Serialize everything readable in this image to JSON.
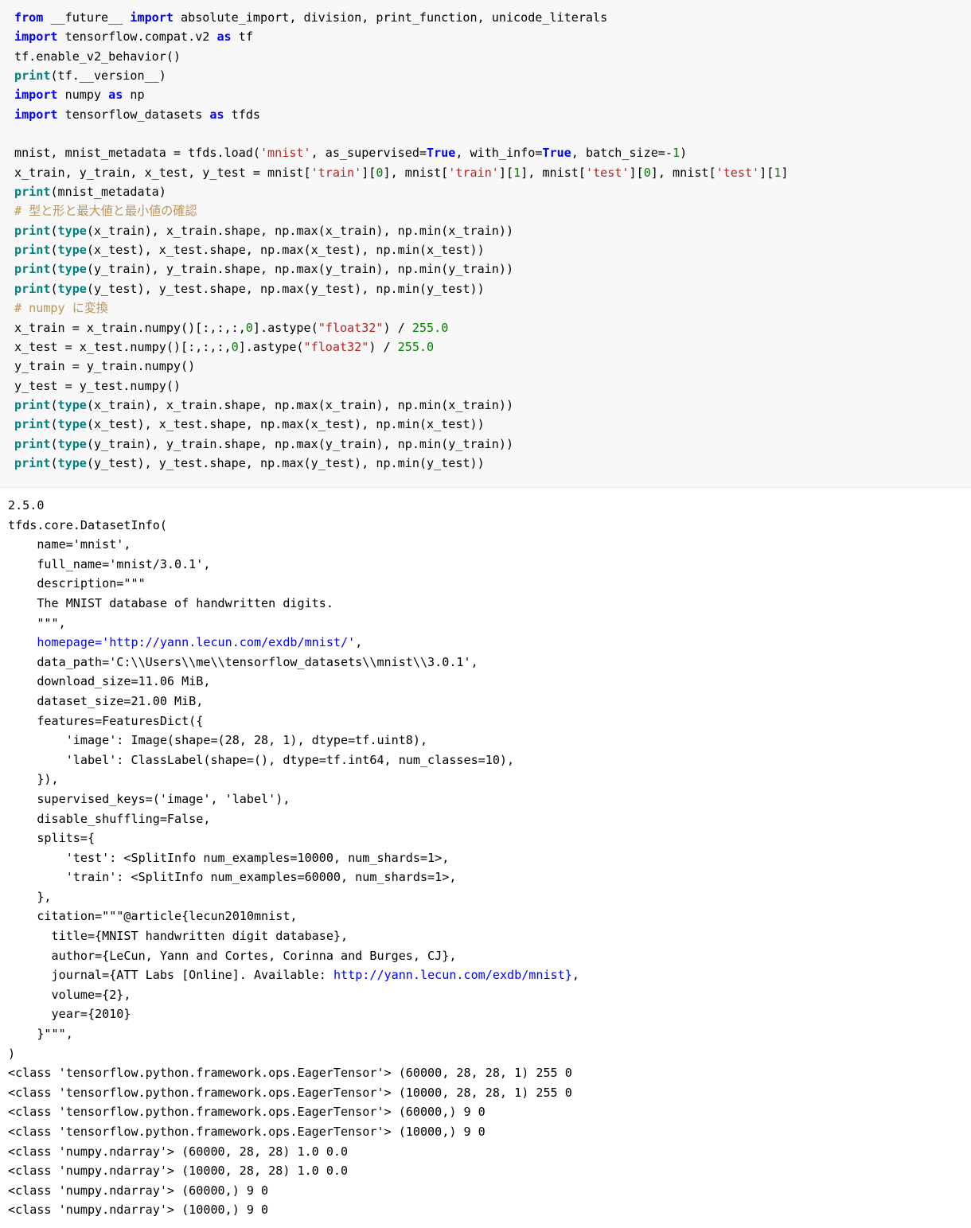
{
  "notebook": {
    "code_cell": {
      "language": "python",
      "background_color": "#f8f8f8",
      "lines": [
        [
          {
            "t": "from",
            "c": "kw"
          },
          {
            "t": " __future__ ",
            "c": ""
          },
          {
            "t": "import",
            "c": "kw"
          },
          {
            "t": " absolute_import, division, print_function, unicode_literals",
            "c": ""
          }
        ],
        [
          {
            "t": "import",
            "c": "kw"
          },
          {
            "t": " tensorflow.compat.v2 ",
            "c": ""
          },
          {
            "t": "as",
            "c": "kw"
          },
          {
            "t": " tf",
            "c": ""
          }
        ],
        [
          {
            "t": "tf.enable_v2_behavior()",
            "c": ""
          }
        ],
        [
          {
            "t": "print",
            "c": "bi"
          },
          {
            "t": "(tf.__version__)",
            "c": ""
          }
        ],
        [
          {
            "t": "import",
            "c": "kw"
          },
          {
            "t": " numpy ",
            "c": ""
          },
          {
            "t": "as",
            "c": "kw"
          },
          {
            "t": " np",
            "c": ""
          }
        ],
        [
          {
            "t": "import",
            "c": "kw"
          },
          {
            "t": " tensorflow_datasets ",
            "c": ""
          },
          {
            "t": "as",
            "c": "kw"
          },
          {
            "t": " tfds",
            "c": ""
          }
        ],
        [
          {
            "t": "",
            "c": ""
          }
        ],
        [
          {
            "t": "mnist, mnist_metadata = tfds.load(",
            "c": ""
          },
          {
            "t": "'mnist'",
            "c": "str"
          },
          {
            "t": ", as_supervised=",
            "c": ""
          },
          {
            "t": "True",
            "c": "cst"
          },
          {
            "t": ", with_info=",
            "c": ""
          },
          {
            "t": "True",
            "c": "cst"
          },
          {
            "t": ", batch_size=-",
            "c": ""
          },
          {
            "t": "1",
            "c": "num"
          },
          {
            "t": ")",
            "c": ""
          }
        ],
        [
          {
            "t": "x_train, y_train, x_test, y_test = mnist[",
            "c": ""
          },
          {
            "t": "'train'",
            "c": "str"
          },
          {
            "t": "][",
            "c": ""
          },
          {
            "t": "0",
            "c": "num"
          },
          {
            "t": "], mnist[",
            "c": ""
          },
          {
            "t": "'train'",
            "c": "str"
          },
          {
            "t": "][",
            "c": ""
          },
          {
            "t": "1",
            "c": "num"
          },
          {
            "t": "], mnist[",
            "c": ""
          },
          {
            "t": "'test'",
            "c": "str"
          },
          {
            "t": "][",
            "c": ""
          },
          {
            "t": "0",
            "c": "num"
          },
          {
            "t": "], mnist[",
            "c": ""
          },
          {
            "t": "'test'",
            "c": "str"
          },
          {
            "t": "][",
            "c": ""
          },
          {
            "t": "1",
            "c": "num"
          },
          {
            "t": "]",
            "c": ""
          }
        ],
        [
          {
            "t": "print",
            "c": "bi"
          },
          {
            "t": "(mnist_metadata)",
            "c": ""
          }
        ],
        [
          {
            "t": "# 型と形と最大値と最小値の確認",
            "c": "cmt"
          }
        ],
        [
          {
            "t": "print",
            "c": "bi"
          },
          {
            "t": "(",
            "c": ""
          },
          {
            "t": "type",
            "c": "bi"
          },
          {
            "t": "(x_train), x_train.shape, np.max(x_train), np.min(x_train))",
            "c": ""
          }
        ],
        [
          {
            "t": "print",
            "c": "bi"
          },
          {
            "t": "(",
            "c": ""
          },
          {
            "t": "type",
            "c": "bi"
          },
          {
            "t": "(x_test), x_test.shape, np.max(x_test), np.min(x_test))",
            "c": ""
          }
        ],
        [
          {
            "t": "print",
            "c": "bi"
          },
          {
            "t": "(",
            "c": ""
          },
          {
            "t": "type",
            "c": "bi"
          },
          {
            "t": "(y_train), y_train.shape, np.max(y_train), np.min(y_train))",
            "c": ""
          }
        ],
        [
          {
            "t": "print",
            "c": "bi"
          },
          {
            "t": "(",
            "c": ""
          },
          {
            "t": "type",
            "c": "bi"
          },
          {
            "t": "(y_test), y_test.shape, np.max(y_test), np.min(y_test))",
            "c": ""
          }
        ],
        [
          {
            "t": "# numpy に変換",
            "c": "cmt"
          }
        ],
        [
          {
            "t": "x_train = x_train.numpy()[:,:,:,",
            "c": ""
          },
          {
            "t": "0",
            "c": "num"
          },
          {
            "t": "].astype(",
            "c": ""
          },
          {
            "t": "\"float32\"",
            "c": "str"
          },
          {
            "t": ") / ",
            "c": ""
          },
          {
            "t": "255.0",
            "c": "num"
          }
        ],
        [
          {
            "t": "x_test = x_test.numpy()[:,:,:,",
            "c": ""
          },
          {
            "t": "0",
            "c": "num"
          },
          {
            "t": "].astype(",
            "c": ""
          },
          {
            "t": "\"float32\"",
            "c": "str"
          },
          {
            "t": ") / ",
            "c": ""
          },
          {
            "t": "255.0",
            "c": "num"
          }
        ],
        [
          {
            "t": "y_train = y_train.numpy()",
            "c": ""
          }
        ],
        [
          {
            "t": "y_test = y_test.numpy()",
            "c": ""
          }
        ],
        [
          {
            "t": "print",
            "c": "bi"
          },
          {
            "t": "(",
            "c": ""
          },
          {
            "t": "type",
            "c": "bi"
          },
          {
            "t": "(x_train), x_train.shape, np.max(x_train), np.min(x_train))",
            "c": ""
          }
        ],
        [
          {
            "t": "print",
            "c": "bi"
          },
          {
            "t": "(",
            "c": ""
          },
          {
            "t": "type",
            "c": "bi"
          },
          {
            "t": "(x_test), x_test.shape, np.max(x_test), np.min(x_test))",
            "c": ""
          }
        ],
        [
          {
            "t": "print",
            "c": "bi"
          },
          {
            "t": "(",
            "c": ""
          },
          {
            "t": "type",
            "c": "bi"
          },
          {
            "t": "(y_train), y_train.shape, np.max(y_train), np.min(y_train))",
            "c": ""
          }
        ],
        [
          {
            "t": "print",
            "c": "bi"
          },
          {
            "t": "(",
            "c": ""
          },
          {
            "t": "type",
            "c": "bi"
          },
          {
            "t": "(y_test), y_test.shape, np.max(y_test), np.min(y_test))",
            "c": ""
          }
        ]
      ]
    },
    "output_cell": {
      "background_color": "#ffffff",
      "lines": [
        [
          {
            "t": "2.5.0",
            "c": ""
          }
        ],
        [
          {
            "t": "tfds.core.DatasetInfo(",
            "c": ""
          }
        ],
        [
          {
            "t": "    name='mnist',",
            "c": ""
          }
        ],
        [
          {
            "t": "    full_name='mnist/3.0.1',",
            "c": ""
          }
        ],
        [
          {
            "t": "    description=\"\"\"",
            "c": ""
          }
        ],
        [
          {
            "t": "    The MNIST database of handwritten digits.",
            "c": ""
          }
        ],
        [
          {
            "t": "    \"\"\",",
            "c": ""
          }
        ],
        [
          {
            "t": "    ",
            "c": ""
          },
          {
            "t": "homepage='http://yann.lecun.com/exdb/mnist/'",
            "c": "lnk"
          },
          {
            "t": ",",
            "c": ""
          }
        ],
        [
          {
            "t": "    data_path='C:\\\\Users\\\\me\\\\tensorflow_datasets\\\\mnist\\\\3.0.1',",
            "c": ""
          }
        ],
        [
          {
            "t": "    download_size=11.06 MiB,",
            "c": ""
          }
        ],
        [
          {
            "t": "    dataset_size=21.00 MiB,",
            "c": ""
          }
        ],
        [
          {
            "t": "    features=FeaturesDict({",
            "c": ""
          }
        ],
        [
          {
            "t": "        'image': Image(shape=(28, 28, 1), dtype=tf.uint8),",
            "c": ""
          }
        ],
        [
          {
            "t": "        'label': ClassLabel(shape=(), dtype=tf.int64, num_classes=10),",
            "c": ""
          }
        ],
        [
          {
            "t": "    }),",
            "c": ""
          }
        ],
        [
          {
            "t": "    supervised_keys=('image', 'label'),",
            "c": ""
          }
        ],
        [
          {
            "t": "    disable_shuffling=False,",
            "c": ""
          }
        ],
        [
          {
            "t": "    splits={",
            "c": ""
          }
        ],
        [
          {
            "t": "        'test': <SplitInfo num_examples=10000, num_shards=1>,",
            "c": ""
          }
        ],
        [
          {
            "t": "        'train': <SplitInfo num_examples=60000, num_shards=1>,",
            "c": ""
          }
        ],
        [
          {
            "t": "    },",
            "c": ""
          }
        ],
        [
          {
            "t": "    citation=\"\"\"@article{lecun2010mnist,",
            "c": ""
          }
        ],
        [
          {
            "t": "      title={MNIST handwritten digit database},",
            "c": ""
          }
        ],
        [
          {
            "t": "      author={LeCun, Yann and Cortes, Corinna and Burges, CJ},",
            "c": ""
          }
        ],
        [
          {
            "t": "      journal={ATT Labs [Online]. Available: ",
            "c": ""
          },
          {
            "t": "http://yann.lecun.com/exdb/mnist}",
            "c": "lnk"
          },
          {
            "t": ",",
            "c": ""
          }
        ],
        [
          {
            "t": "      volume={2},",
            "c": ""
          }
        ],
        [
          {
            "t": "      year={2010}",
            "c": ""
          }
        ],
        [
          {
            "t": "    }\"\"\",",
            "c": ""
          }
        ],
        [
          {
            "t": ")",
            "c": ""
          }
        ],
        [
          {
            "t": "<class 'tensorflow.python.framework.ops.EagerTensor'> (60000, 28, 28, 1) 255 0",
            "c": ""
          }
        ],
        [
          {
            "t": "<class 'tensorflow.python.framework.ops.EagerTensor'> (10000, 28, 28, 1) 255 0",
            "c": ""
          }
        ],
        [
          {
            "t": "<class 'tensorflow.python.framework.ops.EagerTensor'> (60000,) 9 0",
            "c": ""
          }
        ],
        [
          {
            "t": "<class 'tensorflow.python.framework.ops.EagerTensor'> (10000,) 9 0",
            "c": ""
          }
        ],
        [
          {
            "t": "<class 'numpy.ndarray'> (60000, 28, 28) 1.0 0.0",
            "c": ""
          }
        ],
        [
          {
            "t": "<class 'numpy.ndarray'> (10000, 28, 28) 1.0 0.0",
            "c": ""
          }
        ],
        [
          {
            "t": "<class 'numpy.ndarray'> (60000,) 9 0",
            "c": ""
          }
        ],
        [
          {
            "t": "<class 'numpy.ndarray'> (10000,) 9 0",
            "c": ""
          }
        ]
      ]
    },
    "colors": {
      "keyword": "#0000ff",
      "builtin": "#008080",
      "string": "#ba2121",
      "number": "#008000",
      "comment": "#bc9458",
      "link": "#0000ff",
      "text": "#000000",
      "code_background": "#f8f8f8",
      "output_background": "#ffffff"
    }
  }
}
